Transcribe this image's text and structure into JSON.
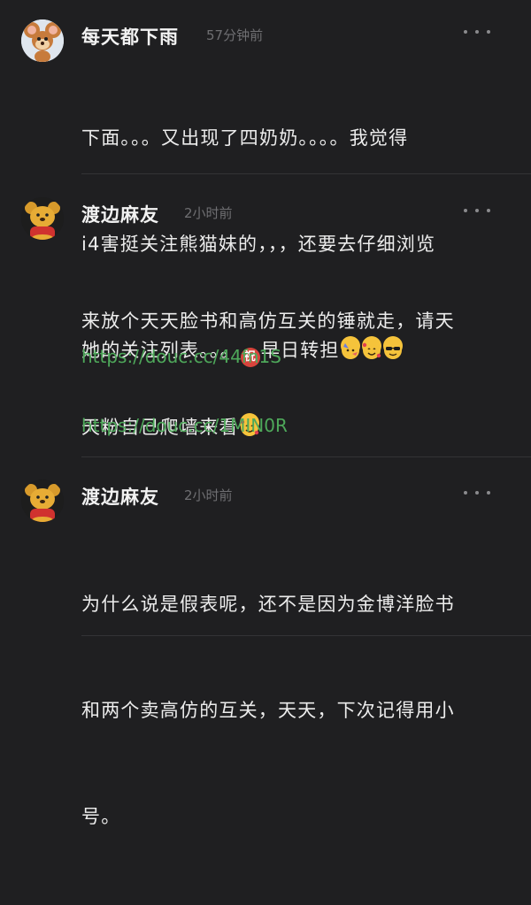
{
  "comments": [
    {
      "author": "每天都下雨",
      "time": "57分钟前",
      "lines": [
        "下面。。。又出现了四奶奶。。。。我觉得",
        "i4害挺关注熊猫妹的，，，还要去仔细浏览",
        "她的关注列表。。。"
      ],
      "line3_suffix": "早日转担",
      "emoji_zhu": "祝",
      "emojis": [
        "partying-face-emoji",
        "smiling-face-with-hearts-emoji",
        "sunglasses-emoji"
      ]
    },
    {
      "author": "渡边麻友",
      "time": "2小时前",
      "lines": [
        "来放个天天脸书和高仿互关的锤就走，请天",
        "天粉自己爬墙来看"
      ],
      "links": [
        "https://douc.cc/44fn1S",
        "https://douc.cc/1MIN0R"
      ]
    },
    {
      "author": "渡边麻友",
      "time": "2小时前",
      "lines": [
        "为什么说是假表呢，还不是因为金博洋脸书",
        "和两个卖高仿的互关，天天，下次记得用小",
        "号。"
      ]
    }
  ],
  "colors": {
    "background": "#1f1f21",
    "link": "#4ea85a",
    "timestamp": "#6f6f72"
  }
}
